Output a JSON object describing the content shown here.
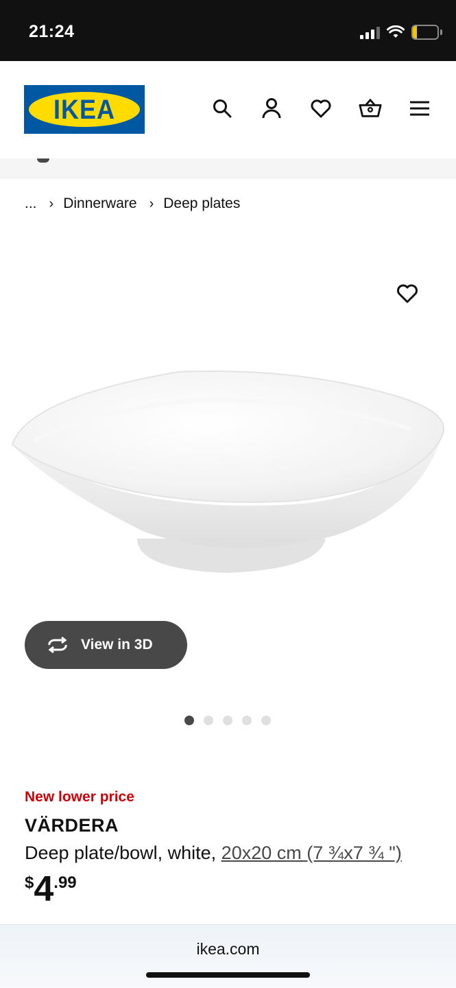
{
  "status_bar": {
    "time": "21:24",
    "battery": "18",
    "battery_percent": 18
  },
  "header": {
    "logo_text": "IKEA",
    "icons": [
      "search-icon",
      "account-icon",
      "favorites-icon",
      "cart-icon",
      "menu-icon"
    ]
  },
  "breadcrumb": {
    "ellipsis": "...",
    "items": [
      "Dinnerware",
      "Deep plates"
    ]
  },
  "media": {
    "view_3d_label": "View in 3D",
    "carousel_count": 5,
    "carousel_active": 1
  },
  "product": {
    "badge": "New lower price",
    "name": "VÄRDERA",
    "description": "Deep plate/bowl, white, ",
    "size_link": "20x20 cm (7 ¾x7 ¾ \")",
    "price_currency": "$",
    "price_integer": "4",
    "price_decimal": ".99"
  },
  "browser": {
    "url": "ikea.com"
  },
  "colors": {
    "ikea_blue": "#0058a3",
    "ikea_yellow": "#ffdb00",
    "badge_red": "#cc0008",
    "dark_gray": "#484848"
  }
}
